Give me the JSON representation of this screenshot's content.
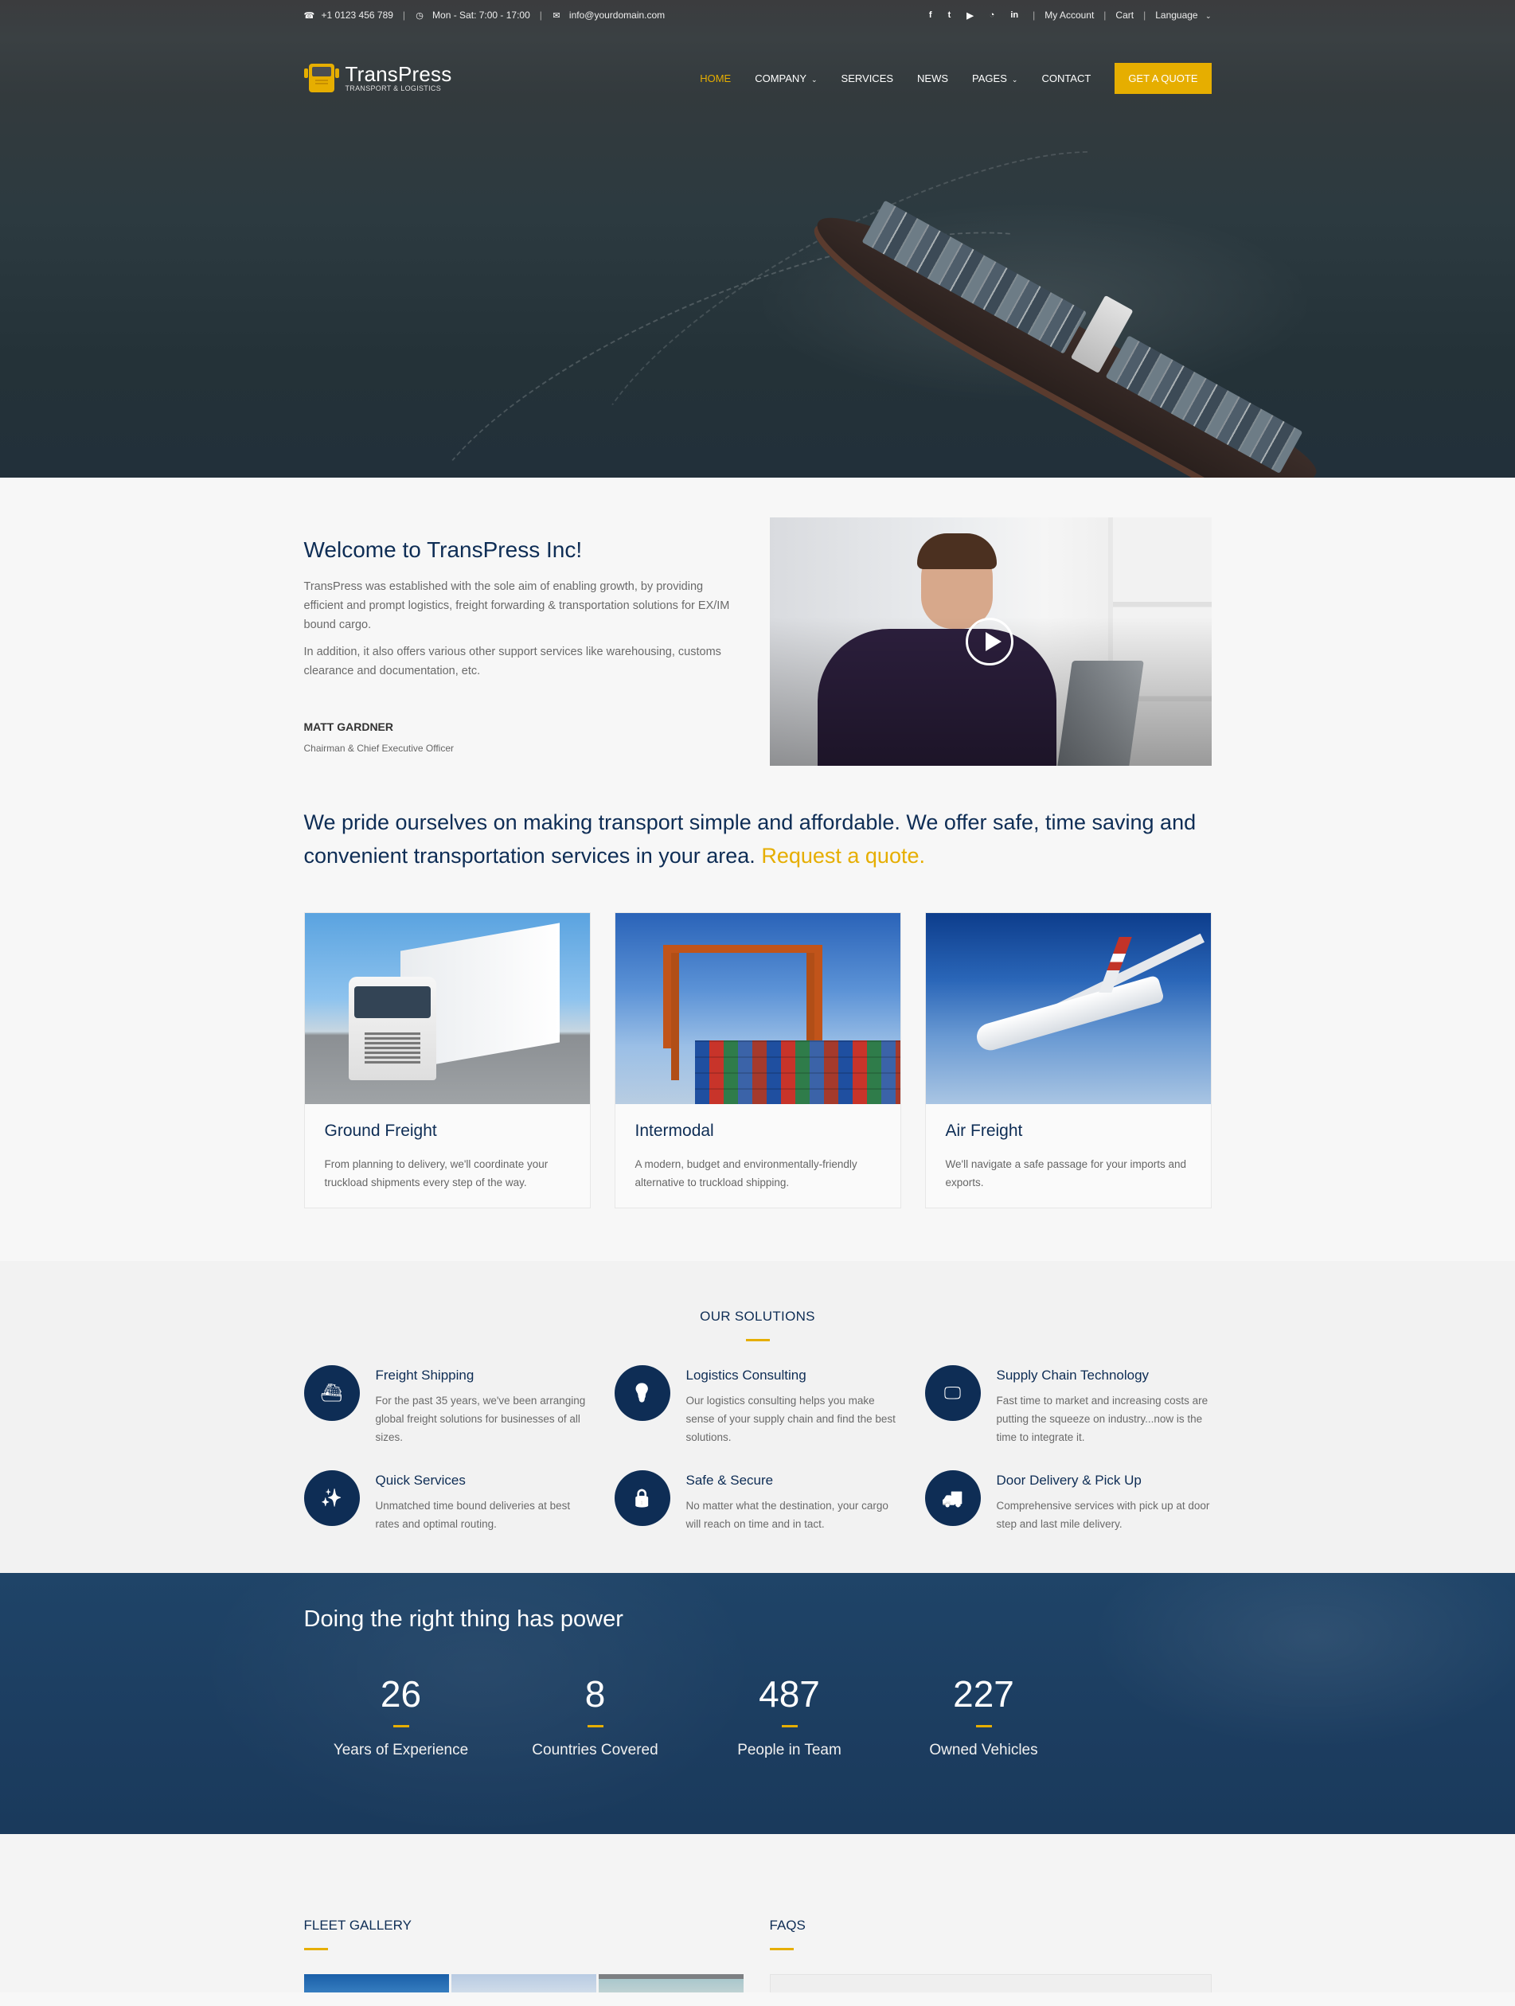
{
  "topbar": {
    "phone": "+1 0123 456 789",
    "hours": "Mon - Sat: 7:00 - 17:00",
    "email": "info@yourdomain.com",
    "social": [
      {
        "name": "facebook-icon",
        "glyph": "f"
      },
      {
        "name": "twitter-icon",
        "glyph": "t"
      },
      {
        "name": "youtube-icon",
        "glyph": "▶"
      },
      {
        "name": "rss-icon",
        "glyph": "◔"
      },
      {
        "name": "linkedin-icon",
        "glyph": "in"
      }
    ],
    "my_account": "My Account",
    "cart": "Cart",
    "language": "Language"
  },
  "brand": {
    "name": "TransPress",
    "tagline": "TRANSPORT & LOGISTICS",
    "accent": "#e6ae00",
    "navy": "#0e2d55"
  },
  "nav": {
    "items": [
      {
        "label": "Home",
        "active": true
      },
      {
        "label": "Company",
        "dropdown": true
      },
      {
        "label": "Services"
      },
      {
        "label": "News"
      },
      {
        "label": "Pages",
        "dropdown": true
      },
      {
        "label": "Contact"
      }
    ],
    "cta": "Get a Quote"
  },
  "welcome": {
    "title": "Welcome to TransPress Inc!",
    "p1": "TransPress was established with the sole aim of enabling growth, by providing efficient and prompt logistics, freight forwarding & transportation solutions for EX/IM bound cargo.",
    "p2": "In addition, it also offers various other support services like warehousing, customs clearance and documentation, etc.",
    "signer_name": "MATT GARDNER",
    "signer_role": "Chairman & Chief Executive Officer"
  },
  "pride": {
    "text": "We pride ourselves on making transport simple and affordable. We offer safe, time saving and convenient transportation services in your area.",
    "link": "Request a quote."
  },
  "services": [
    {
      "title": "Ground Freight",
      "text": "From planning to delivery, we'll coordinate your truckload shipments every step of the way."
    },
    {
      "title": "Intermodal",
      "text": "A modern, budget and environmentally-friendly alternative to truckload shipping."
    },
    {
      "title": "Air Freight",
      "text": "We'll navigate a safe passage for your imports and exports."
    }
  ],
  "solutions": {
    "title": "Our Solutions",
    "items": [
      {
        "icon": "ship-icon",
        "glyph": "⛴",
        "title": "Freight Shipping",
        "text": "For the past 35 years, we've been arranging global freight solutions for businesses of all sizes."
      },
      {
        "icon": "lightbulb-icon",
        "glyph": "💡",
        "title": "Logistics Consulting",
        "text": "Our logistics consulting helps you make sense of your supply chain and find the best solutions."
      },
      {
        "icon": "monitor-icon",
        "glyph": "🖵",
        "title": "Supply Chain Technology",
        "text": "Fast time to market and increasing costs are putting the squeeze on industry...now is the time to integrate it."
      },
      {
        "icon": "magic-wand-icon",
        "glyph": "✨",
        "title": "Quick Services",
        "text": "Unmatched time bound deliveries at best rates and optimal routing."
      },
      {
        "icon": "lock-icon",
        "glyph": "🔒",
        "title": "Safe & Secure",
        "text": "No matter what the destination, your cargo will reach on time and in tact."
      },
      {
        "icon": "truck-icon",
        "glyph": "🚚",
        "title": "Door Delivery & Pick Up",
        "text": "Comprehensive services with pick up at door step and last mile delivery."
      }
    ]
  },
  "stats": {
    "title": "Doing the right thing has power",
    "items": [
      {
        "value": "26",
        "label": "Years of Experience"
      },
      {
        "value": "8",
        "label": "Countries Covered"
      },
      {
        "value": "487",
        "label": "People in Team"
      },
      {
        "value": "227",
        "label": "Owned Vehicles"
      }
    ]
  },
  "bottom": {
    "gallery_title": "Fleet Gallery",
    "faqs_title": "FAQs"
  }
}
